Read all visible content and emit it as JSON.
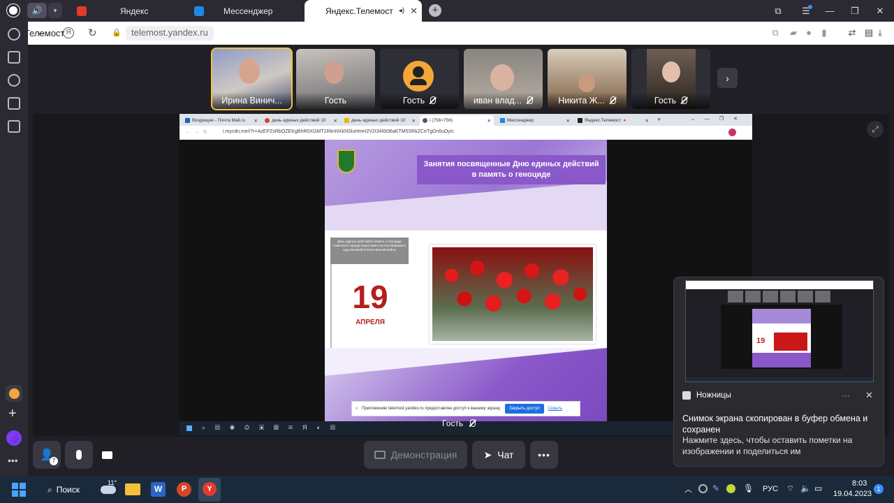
{
  "browser": {
    "tabs": [
      {
        "label": "Яндекс",
        "icon": "yandex-icon",
        "color": "#e23a2f"
      },
      {
        "label": "Мессенджер",
        "icon": "messenger-icon",
        "color": "#1e88e5"
      },
      {
        "label": "Яндекс.Телемост",
        "icon": "telemost-icon",
        "color": "#2c2c2c",
        "active": true
      }
    ],
    "url": "telemost.yandex.ru",
    "page_title": "Яндекс.Телемост"
  },
  "participants": [
    {
      "name": "Ирина Винич...",
      "speaking": true,
      "muted": false,
      "bg": "#6b7aa6"
    },
    {
      "name": "Гость",
      "muted": false,
      "bg": "#5a5c63"
    },
    {
      "name": "Гость",
      "muted": true,
      "avatar": true,
      "bg": "#2e2e36"
    },
    {
      "name": "иван влад...",
      "muted": true,
      "bg": "#6e6a66"
    },
    {
      "name": "Никита Ж...",
      "muted": true,
      "bg": "#7a6b5c"
    },
    {
      "name": "Гость",
      "muted": true,
      "bg": "#4a4642"
    }
  ],
  "shared": {
    "tabs": [
      "Входящие - Почта Mail.ru",
      "день единых действий 10",
      "день единых действий 10",
      "i (756×756)",
      "Мессенджер",
      "Яндекс.Телемост"
    ],
    "url": "i.mycdn.me/i?r=AzEPZsRbOZEKgBhR0XGMT1RknNXkNSluHmH2V2I34I0t36aKTM5SRkZCeTgDn6uOyic",
    "slide": {
      "heading": "Занятия посвященные Дню единых действий в память о геноциде",
      "small_text": "День единых действий в память о геноциде советского народа нацистами и их пособниками в годы Великой Отечественной войны",
      "day": "19",
      "month": "АПРЕЛЯ"
    },
    "access_bar": {
      "text": "Приложению telemost.yandex.ru предоставлен доступ к вашему экрану.",
      "close": "Закрыть доступ",
      "hide": "Скрыть"
    },
    "presenter": "Гость"
  },
  "controls": {
    "demo": "Демонстрация",
    "chat": "Чат",
    "invite_badge": "7"
  },
  "notification": {
    "app": "Ножницы",
    "title": "Снимок экрана скопирован в буфер обмена и сохранен",
    "body": "Нажмите здесь, чтобы оставить пометки на изображении и поделиться им",
    "more": "···"
  },
  "taskbar": {
    "search": "Поиск",
    "temperature": "11°",
    "lang": "РУС",
    "time": "8:03",
    "date": "19.04.2023",
    "notif_count": "1"
  },
  "colors": {
    "accent_yellow": "#f4c33b",
    "slide_purple": "#8a58c9",
    "date_red": "#b51f1f",
    "access_blue": "#1d6fe0"
  }
}
